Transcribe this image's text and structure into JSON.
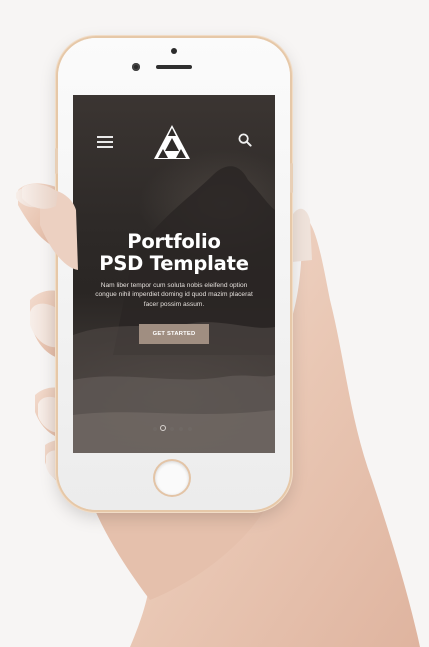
{
  "hero": {
    "title_line1": "Portfolio",
    "title_line2": "PSD Template",
    "text": "Nam liber tempor cum soluta nobis eleifend option congue nihil imperdiet doming id quod mazim placerat facer possim assum.",
    "cta_label": "GET STARTED"
  },
  "header": {
    "menu_icon": "hamburger-menu-icon",
    "logo_icon": "triangle-logo-icon",
    "search_icon": "search-icon"
  },
  "slider": {
    "total": 5,
    "active_index": 1
  },
  "colors": {
    "cta": "#a08e81",
    "screen_bg": "#2e2a28",
    "phone_trim": "#e6c8a8",
    "text": "#ffffff"
  }
}
